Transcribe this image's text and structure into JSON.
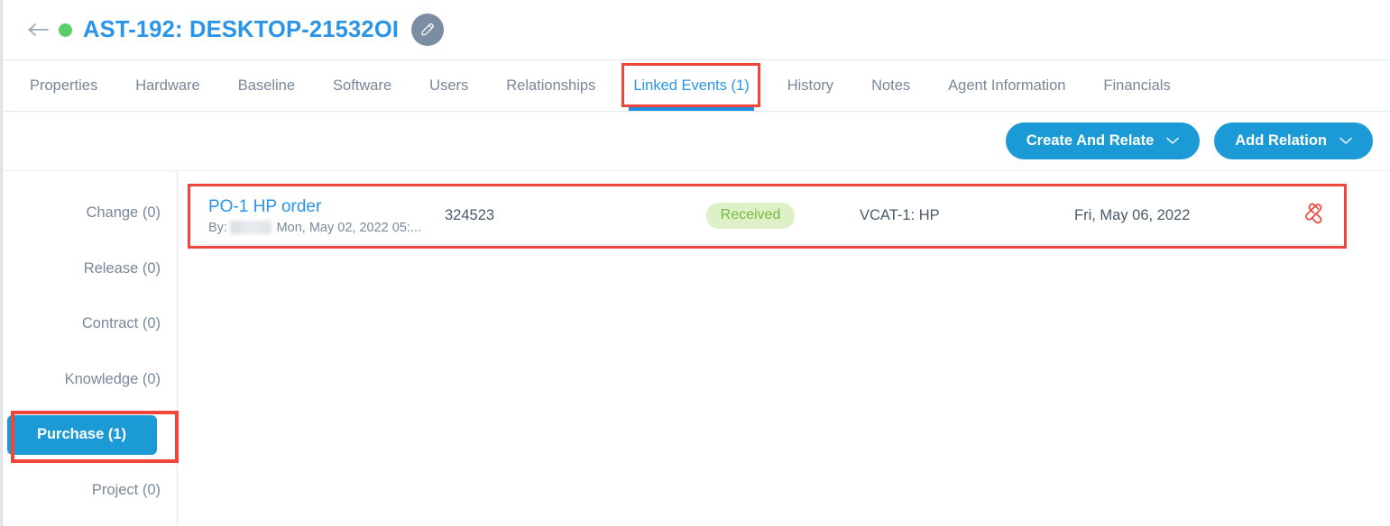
{
  "header": {
    "back_icon": "back-arrow-icon",
    "status_dot": "online-status-dot",
    "status_color": "#58d06a",
    "title": "AST-192: DESKTOP-21532OI",
    "title_color": "#2a95e8",
    "edit_icon": "pencil-icon"
  },
  "tabs": [
    {
      "label": "Properties",
      "active": false
    },
    {
      "label": "Hardware",
      "active": false
    },
    {
      "label": "Baseline",
      "active": false
    },
    {
      "label": "Software",
      "active": false
    },
    {
      "label": "Users",
      "active": false
    },
    {
      "label": "Relationships",
      "active": false
    },
    {
      "label": "Linked Events (1)",
      "active": true
    },
    {
      "label": "History",
      "active": false
    },
    {
      "label": "Notes",
      "active": false
    },
    {
      "label": "Agent Information",
      "active": false
    },
    {
      "label": "Financials",
      "active": false
    }
  ],
  "actionbar": {
    "create_and_relate": "Create And Relate",
    "add_relation": "Add Relation",
    "caret_icon": "chevron-down-icon",
    "button_color": "#1c9ad6"
  },
  "sidebar": {
    "items": [
      {
        "label": "Change (0)",
        "active": false
      },
      {
        "label": "Release (0)",
        "active": false
      },
      {
        "label": "Contract (0)",
        "active": false
      },
      {
        "label": "Knowledge (0)",
        "active": false
      },
      {
        "label": "Purchase (1)",
        "active": true
      },
      {
        "label": "Project (0)",
        "active": false
      }
    ],
    "active_color": "#1c9ad6"
  },
  "events": {
    "rows": [
      {
        "title": "PO-1 HP order",
        "by_label": "By:",
        "by_user_redacted": true,
        "created": "Mon, May 02, 2022 05:...",
        "number": "324523",
        "status": "Received",
        "status_bg": "#ddf0c8",
        "status_fg": "#76bb3e",
        "vendor": "VCAT-1: HP",
        "date": "Fri, May 06, 2022",
        "action_icon": "unlink-icon",
        "action_color": "#f0453a"
      }
    ]
  },
  "highlights": {
    "color": "#f0453a",
    "targets": [
      "tab-linked-events",
      "sidebar-item-purchase",
      "event-row"
    ]
  }
}
